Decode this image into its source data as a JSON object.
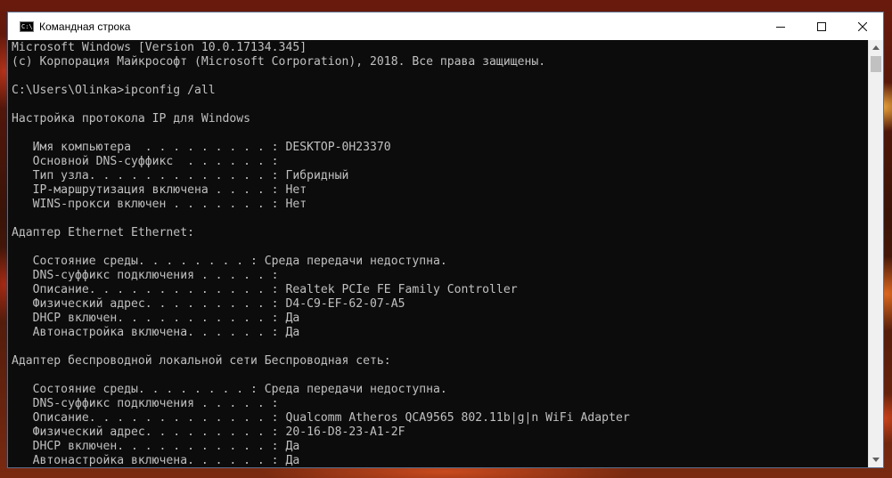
{
  "window": {
    "title": "Командная строка",
    "icon_name": "cmd-icon",
    "icon_text": "C:\\."
  },
  "controls": {
    "minimize": "minimize-icon",
    "maximize": "maximize-icon",
    "close": "close-icon"
  },
  "console": {
    "colors": {
      "background": "#0c0c0c",
      "text": "#c0c0c0"
    },
    "lines": [
      "Microsoft Windows [Version 10.0.17134.345]",
      "(c) Корпорация Майкрософт (Microsoft Corporation), 2018. Все права защищены.",
      "",
      "C:\\Users\\Olinka>ipconfig /all",
      "",
      "Настройка протокола IP для Windows",
      "",
      "   Имя компьютера  . . . . . . . . . : DESKTOP-0H23370",
      "   Основной DNS-суффикс  . . . . . . :",
      "   Тип узла. . . . . . . . . . . . . : Гибридный",
      "   IP-маршрутизация включена . . . . : Нет",
      "   WINS-прокси включен . . . . . . . : Нет",
      "",
      "Адаптер Ethernet Ethernet:",
      "",
      "   Состояние среды. . . . . . . . : Среда передачи недоступна.",
      "   DNS-суффикс подключения . . . . . :",
      "   Описание. . . . . . . . . . . . . : Realtek PCIe FE Family Controller",
      "   Физический адрес. . . . . . . . . : D4-C9-EF-62-07-A5",
      "   DHCP включен. . . . . . . . . . . : Да",
      "   Автонастройка включена. . . . . . : Да",
      "",
      "Адаптер беспроводной локальной сети Беспроводная сеть:",
      "",
      "   Состояние среды. . . . . . . . : Среда передачи недоступна.",
      "   DNS-суффикс подключения . . . . . :",
      "   Описание. . . . . . . . . . . . . : Qualcomm Atheros QCA9565 802.11b|g|n WiFi Adapter",
      "   Физический адрес. . . . . . . . . : 20-16-D8-23-A1-2F",
      "   DHCP включен. . . . . . . . . . . : Да",
      "   Автонастройка включена. . . . . . : Да"
    ]
  }
}
